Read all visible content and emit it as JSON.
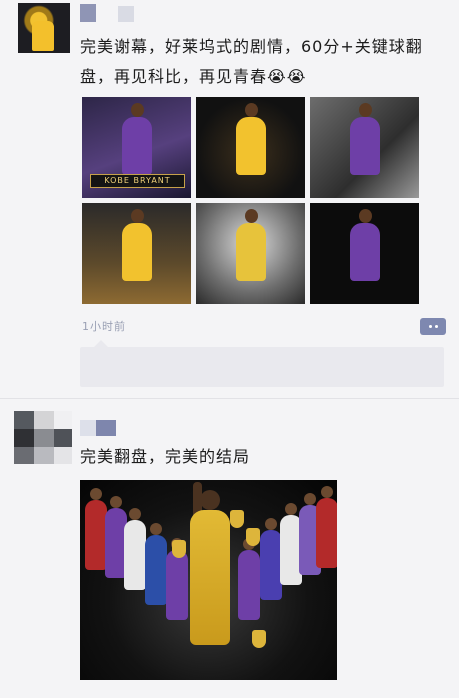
{
  "posts": [
    {
      "text": "完美谢幕，好莱坞式的剧情，60分+关键球翻盘，再见科比，再见青春😭😭",
      "images": [
        {
          "caption": "KOBE BRYANT"
        },
        {
          "caption": ""
        },
        {
          "caption": ""
        },
        {
          "caption": ""
        },
        {
          "caption": ""
        },
        {
          "caption": ""
        }
      ],
      "time": "1小时前"
    },
    {
      "text": "完美翻盘，完美的结局"
    }
  ],
  "colors": {
    "background": "#f4f4f6",
    "more_button": "#7e88b0",
    "time_text": "#9aa0b4",
    "lakers_purple": "#6e3fa7",
    "lakers_gold": "#f2c22e"
  },
  "icons": {
    "more": "more-dots-icon"
  }
}
